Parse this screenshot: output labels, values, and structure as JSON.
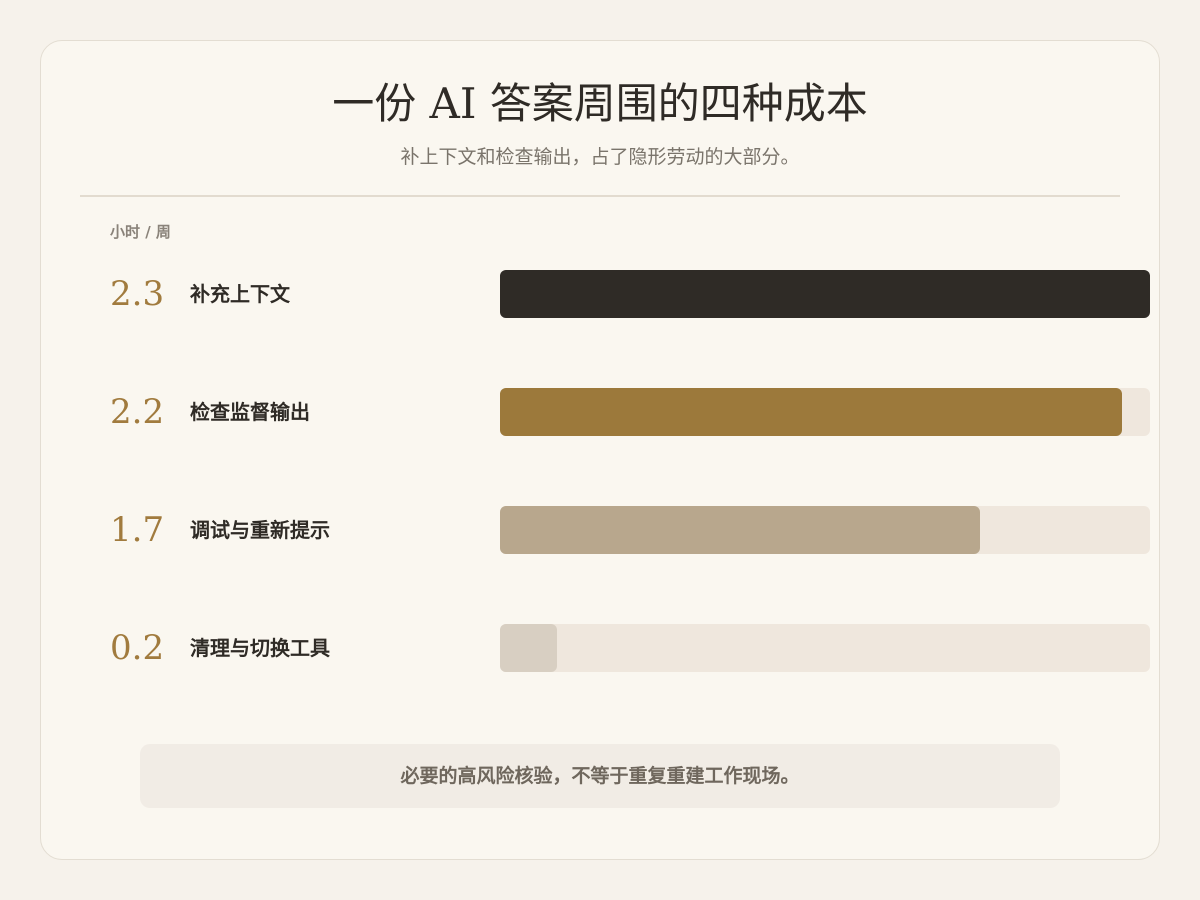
{
  "header": {
    "title": "一份 AI 答案周围的四种成本",
    "subtitle": "补上下文和检查输出，占了隐形劳动的大部分。"
  },
  "chart_data": {
    "type": "bar",
    "orientation": "horizontal",
    "unit_label": "小时 / 周",
    "categories": [
      "补充上下文",
      "检查监督输出",
      "调试与重新提示",
      "清理与切换工具"
    ],
    "values": [
      2.3,
      2.2,
      1.7,
      0.2
    ],
    "value_labels": [
      "2.3",
      "2.2",
      "1.7",
      "0.2"
    ],
    "xlim": [
      0,
      2.3
    ],
    "grid": false,
    "legend": "none",
    "colors": [
      "#2f2b26",
      "#9c793b",
      "#b8a78d",
      "#d8cfc2"
    ],
    "track_color": "#efe7dd"
  },
  "footer": {
    "note": "必要的高风险核验，不等于重复重建工作现场。"
  }
}
